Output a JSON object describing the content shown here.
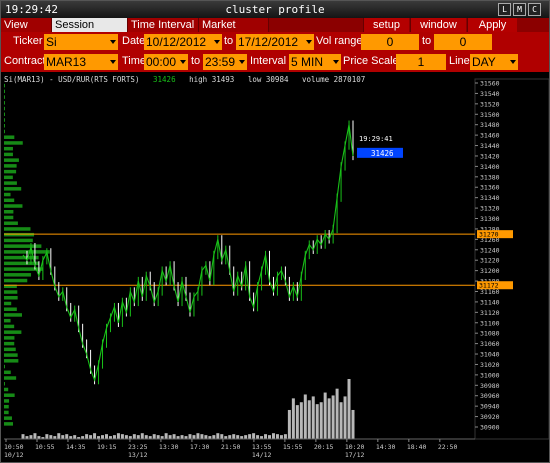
{
  "titlebar": {
    "clock": "19:29:42",
    "title": "cluster profile",
    "buttons": [
      "L",
      "M",
      "C"
    ]
  },
  "tabs": [
    {
      "label": "View DOM",
      "active": false
    },
    {
      "label": "Session Hours",
      "active": true
    },
    {
      "label": "Time Interval",
      "active": false
    },
    {
      "label": "Market Watch",
      "active": false
    }
  ],
  "toolbar_buttons": {
    "setup": "setup",
    "window": "window",
    "apply": "Apply"
  },
  "row1": {
    "ticker_label": "Ticker",
    "ticker_value": "Si",
    "date_label": "Date",
    "date_from": "10/12/2012",
    "to_label": "to",
    "date_to": "17/12/2012",
    "vol_range_label": "Vol range",
    "vol_from": "0",
    "vol_to_label": "to",
    "vol_to": "0"
  },
  "row2": {
    "contract_label": "Contract",
    "contract_value": "MAR13",
    "time_label": "Time",
    "time_from": "00:00",
    "to_label": "to",
    "time_to": "23:59",
    "interval_label": "Interval",
    "interval_value": "5 MIN",
    "price_scale_label": "Price Scale",
    "price_scale_value": "1",
    "line_label": "Line",
    "line_value": "DAY"
  },
  "chart_info": {
    "symbol": "Si(MAR13) - USD/RUR(RTS FORTS)",
    "last": "31426",
    "high": "high 31493",
    "low": "low 30984",
    "volume": "volume 2870107"
  },
  "chart_data": {
    "type": "line",
    "title": "Si(MAR13) - USD/RUR(RTS FORTS)",
    "ylim": [
      30900,
      31560
    ],
    "y_ticks": [
      31560,
      31540,
      31520,
      31500,
      31480,
      31460,
      31440,
      31420,
      31400,
      31380,
      31360,
      31340,
      31320,
      31300,
      31280,
      31260,
      31240,
      31220,
      31200,
      31180,
      31160,
      31140,
      31120,
      31100,
      31080,
      31060,
      31040,
      31020,
      31000,
      30980,
      30960,
      30940,
      30920,
      30900
    ],
    "x_ticks": [
      {
        "t": "10:50",
        "d": "10/12"
      },
      {
        "t": "10:55",
        "d": ""
      },
      {
        "t": "14:35",
        "d": ""
      },
      {
        "t": "19:15",
        "d": ""
      },
      {
        "t": "23:25",
        "d": "13/12"
      },
      {
        "t": "13:30",
        "d": ""
      },
      {
        "t": "17:30",
        "d": ""
      },
      {
        "t": "21:50",
        "d": ""
      },
      {
        "t": "13:55",
        "d": "14/12"
      },
      {
        "t": "15:55",
        "d": ""
      },
      {
        "t": "20:15",
        "d": ""
      },
      {
        "t": "10:20",
        "d": "17/12"
      },
      {
        "t": "14:30",
        "d": ""
      },
      {
        "t": "18:40",
        "d": ""
      },
      {
        "t": "22:50",
        "d": ""
      }
    ],
    "price_series": [
      31230,
      31220,
      31245,
      31210,
      31190,
      31220,
      31235,
      31200,
      31170,
      31150,
      31160,
      31130,
      31110,
      31125,
      31090,
      31060,
      31040,
      31010,
      30990,
      31020,
      31060,
      31090,
      31110,
      31130,
      31100,
      31140,
      31120,
      31160,
      31140,
      31180,
      31150,
      31190,
      31170,
      31140,
      31160,
      31200,
      31180,
      31210,
      31170,
      31140,
      31180,
      31150,
      31120,
      31150,
      31160,
      31200,
      31210,
      31180,
      31230,
      31260,
      31220,
      31240,
      31200,
      31160,
      31190,
      31170,
      31210,
      31150,
      31130,
      31170,
      31200,
      31230,
      31180,
      31160,
      31190,
      31200,
      31180,
      31150,
      31170,
      31150,
      31190,
      31230,
      31250,
      31240,
      31260,
      31250,
      31270,
      31260,
      31280,
      31340,
      31400,
      31440,
      31480,
      31420
    ],
    "volume_series": [
      5,
      3,
      4,
      6,
      3,
      2,
      5,
      4,
      3,
      6,
      4,
      5,
      3,
      4,
      2,
      3,
      5,
      4,
      6,
      3,
      4,
      5,
      3,
      4,
      6,
      5,
      4,
      3,
      5,
      4,
      6,
      4,
      3,
      5,
      4,
      3,
      6,
      4,
      5,
      3,
      4,
      3,
      5,
      4,
      6,
      5,
      4,
      3,
      4,
      6,
      5,
      3,
      4,
      5,
      4,
      3,
      4,
      5,
      6,
      4,
      3,
      5,
      4,
      6,
      5,
      4,
      5,
      30,
      42,
      35,
      38,
      46,
      40,
      44,
      36,
      38,
      48,
      42,
      45,
      52,
      38,
      44,
      62,
      30
    ],
    "annotations": {
      "current_time_label": "19:29:41",
      "current_price": "31426",
      "level_high": "31270",
      "level_low": "31172"
    },
    "grid": false,
    "legend": "none"
  },
  "colors": {
    "up": "#19c119",
    "down": "#ffffff",
    "profile": "#1aa31a",
    "level": "#ff9900",
    "price_tag": "#0044ff",
    "volume": "#cccccc"
  }
}
